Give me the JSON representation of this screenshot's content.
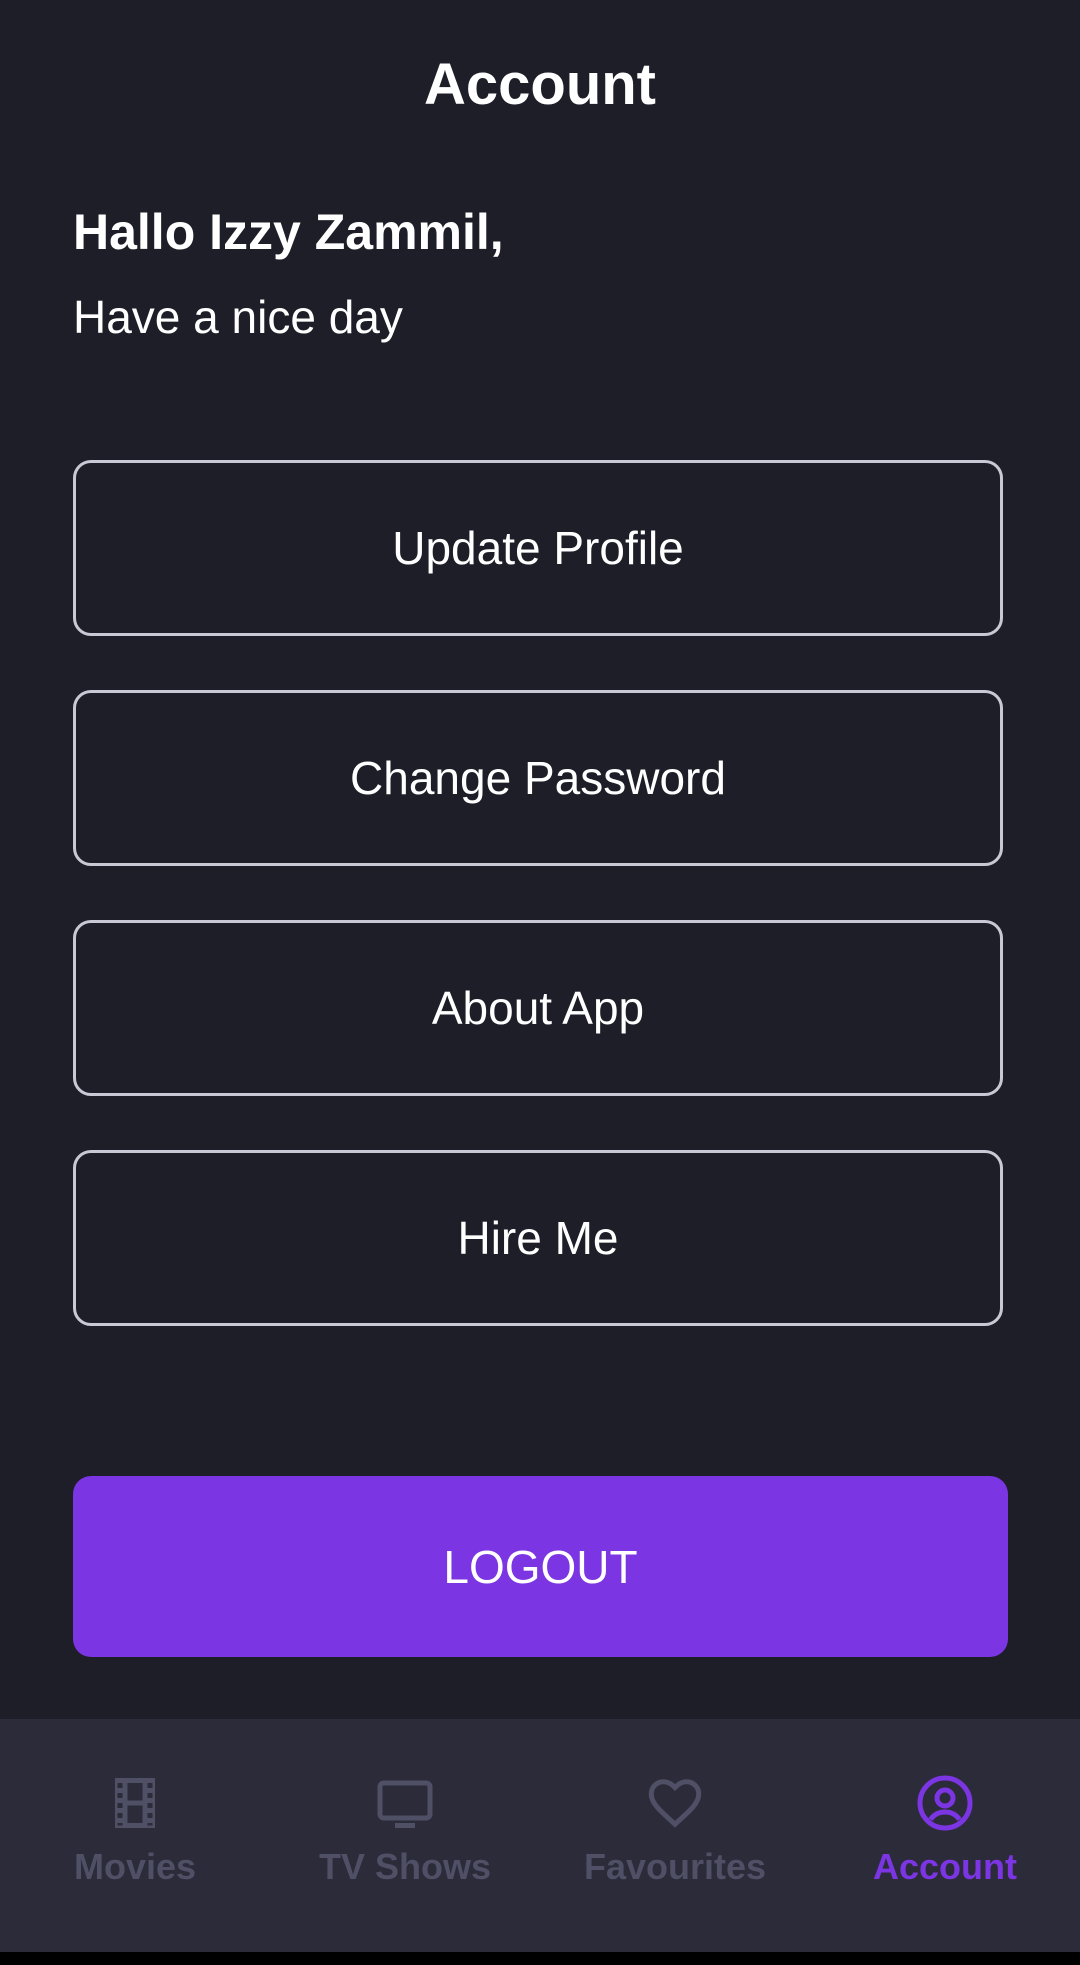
{
  "header": {
    "title": "Account"
  },
  "greeting": {
    "title": "Hallo Izzy Zammil,",
    "subtitle": "Have a nice day"
  },
  "menu": {
    "items": [
      {
        "label": "Update Profile"
      },
      {
        "label": "Change Password"
      },
      {
        "label": "About App"
      },
      {
        "label": "Hire Me"
      }
    ]
  },
  "logout": {
    "label": "LOGOUT"
  },
  "nav": {
    "items": [
      {
        "label": "Movies",
        "icon": "film-icon",
        "active": false
      },
      {
        "label": "TV Shows",
        "icon": "tv-icon",
        "active": false
      },
      {
        "label": "Favourites",
        "icon": "heart-icon",
        "active": false
      },
      {
        "label": "Account",
        "icon": "account-circle-icon",
        "active": true
      }
    ]
  },
  "colors": {
    "background": "#1e1e28",
    "nav_background": "#2b2b3a",
    "accent": "#7c35e3",
    "inactive": "#4f4f66",
    "button_border": "#c9c9d6"
  }
}
